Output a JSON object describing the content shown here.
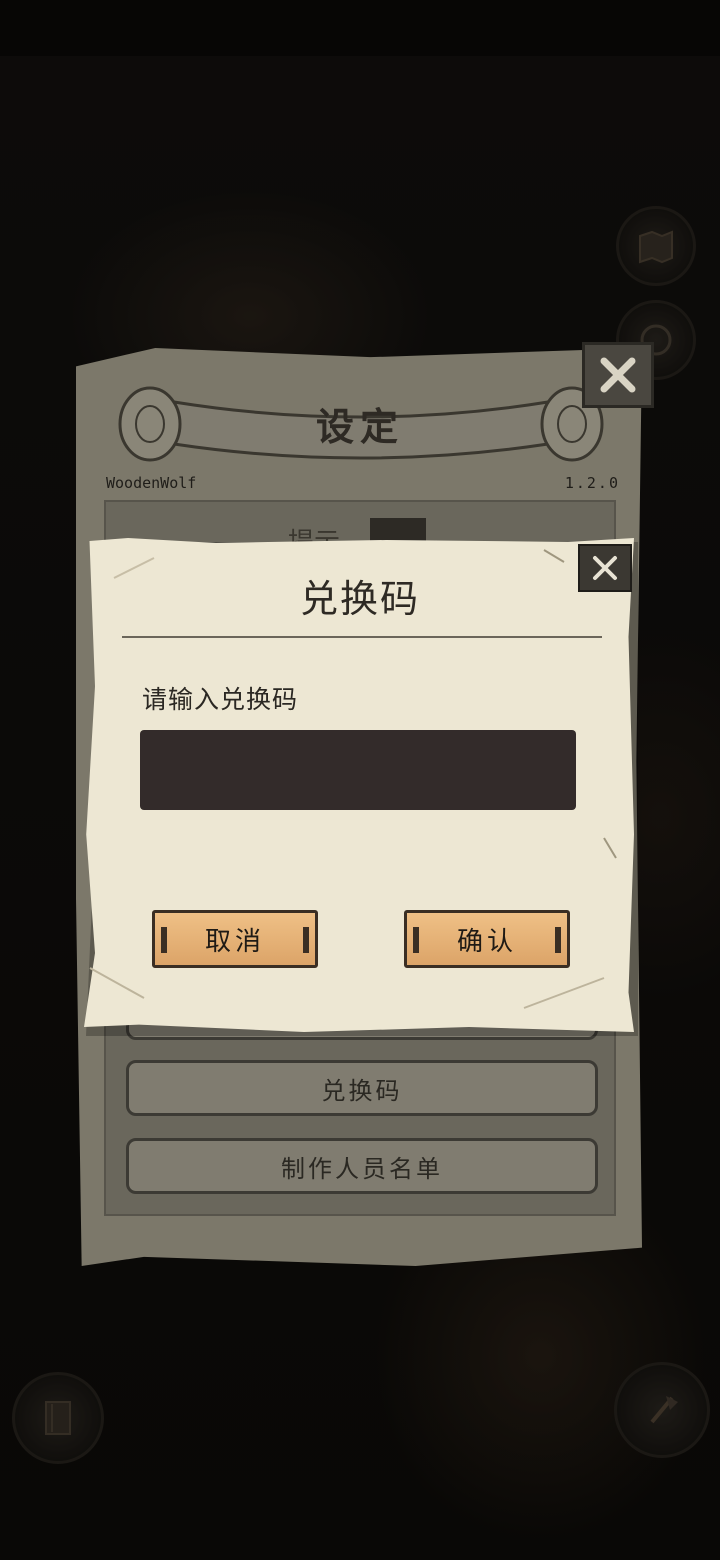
{
  "settings": {
    "title": "设定",
    "player_name": "WoodenWolf",
    "version": "1.2.0",
    "hint_label": "提示",
    "buttons": {
      "redeem": "兑换码",
      "credits": "制作人员名单"
    }
  },
  "redeem_dialog": {
    "title": "兑换码",
    "prompt": "请输入兑换码",
    "input_value": "",
    "cancel_label": "取消",
    "confirm_label": "确认"
  },
  "icons": {
    "top_right_1": "map-icon",
    "top_right_2": "tap-icon",
    "bottom_left": "door-icon",
    "bottom_right": "axe-icon"
  },
  "colors": {
    "dialog_paper": "#ede7d3",
    "input_bg": "#332b2a",
    "plank": "#dca468",
    "panel": "#7c786a"
  }
}
